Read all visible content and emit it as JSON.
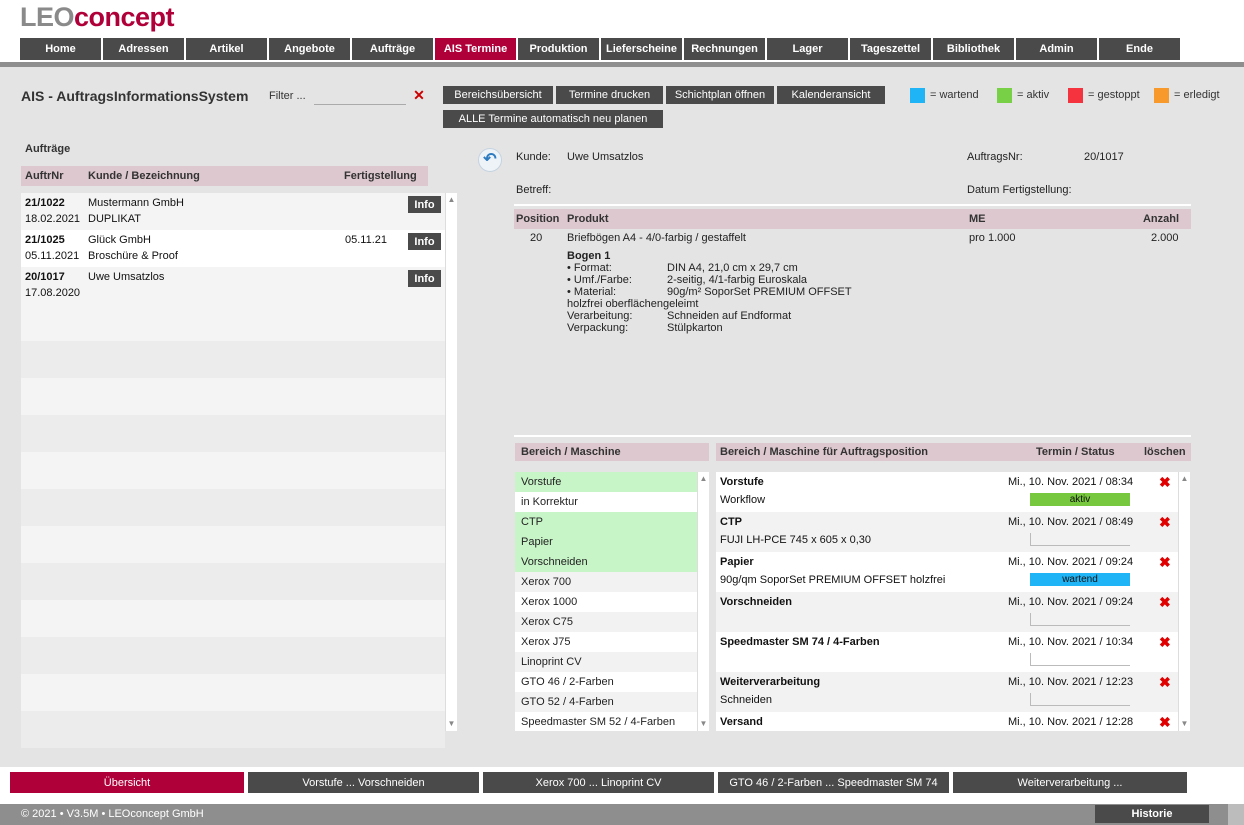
{
  "logo": {
    "leo": "LEO",
    "concept": "concept"
  },
  "nav": [
    {
      "label": "Home",
      "active": false
    },
    {
      "label": "Adressen",
      "active": false
    },
    {
      "label": "Artikel",
      "active": false
    },
    {
      "label": "Angebote",
      "active": false
    },
    {
      "label": "Aufträge",
      "active": false
    },
    {
      "label": "AIS Termine",
      "active": true
    },
    {
      "label": "Produktion",
      "active": false
    },
    {
      "label": "Lieferscheine",
      "active": false
    },
    {
      "label": "Rechnungen",
      "active": false
    },
    {
      "label": "Lager",
      "active": false
    },
    {
      "label": "Tageszettel",
      "active": false
    },
    {
      "label": "Bibliothek",
      "active": false
    },
    {
      "label": "Admin",
      "active": false
    },
    {
      "label": "Ende",
      "active": false
    }
  ],
  "page_title": "AIS - AuftragsInformationsSystem",
  "filter": {
    "label": "Filter ...",
    "value": ""
  },
  "toolbar": {
    "bereich": "Bereichsübersicht",
    "drucken": "Termine drucken",
    "schicht": "Schichtplan öffnen",
    "kalender": "Kalenderansicht",
    "neu_planen": "ALLE Termine automatisch neu planen"
  },
  "legend": [
    {
      "color": "#1fb4f5",
      "label": "= wartend"
    },
    {
      "color": "#77d046",
      "label": "= aktiv"
    },
    {
      "color": "#f5333f",
      "label": "= gestoppt"
    },
    {
      "color": "#f89a2b",
      "label": "= erledigt"
    }
  ],
  "orders": {
    "section_label": "Aufträge",
    "columns": {
      "nr": "AuftrNr",
      "kunde": "Kunde / Bezeichnung",
      "fert": "Fertigstellung"
    },
    "info_label": "Info",
    "rows": [
      {
        "nr": "21/1022",
        "date": "18.02.2021",
        "customer": "Mustermann GmbH",
        "desc": " DUPLIKAT",
        "fert": ""
      },
      {
        "nr": "21/1025",
        "date": "05.11.2021",
        "customer": "Glück GmbH",
        "desc": "Broschüre & Proof",
        "fert": "05.11.21"
      },
      {
        "nr": "20/1017",
        "date": "17.08.2020",
        "customer": "Uwe Umsatzlos",
        "desc": "",
        "fert": ""
      }
    ]
  },
  "detail": {
    "kunde_label": "Kunde:",
    "kunde": "Uwe Umsatzlos",
    "auftrag_label": "AuftragsNr:",
    "auftrag": "20/1017",
    "betreff_label": "Betreff:",
    "datum_label": "Datum Fertigstellung:",
    "columns": {
      "pos": "Position",
      "produkt": "Produkt",
      "me": "ME",
      "anzahl": "Anzahl"
    },
    "position": "20",
    "produkt": "Briefbögen A4 - 4/0-farbig / gestaffelt",
    "me": "pro 1.000",
    "anzahl": "2.000",
    "bogen_title": "Bogen 1",
    "spec_keys": "• Format:\n• Umf./Farbe:\n• Material:",
    "spec_vals": "DIN A4, 21,0 cm x 29,7 cm\n2-seitig, 4/1-farbig Euroskala\n90g/m² SoporSet PREMIUM OFFSET",
    "spec_extra": "holzfrei oberflächengeleimt",
    "spec_keys2": "Verarbeitung:\nVerpackung:",
    "spec_vals2": "Schneiden auf Endformat\nStülpkarton"
  },
  "machines": {
    "header": "Bereich / Maschine",
    "items": [
      {
        "label": "Vorstufe",
        "state": "green"
      },
      {
        "label": "in Korrektur",
        "state": "white"
      },
      {
        "label": "CTP",
        "state": "green"
      },
      {
        "label": "Papier",
        "state": "green"
      },
      {
        "label": "Vorschneiden",
        "state": "green"
      },
      {
        "label": "Xerox 700",
        "state": "alt"
      },
      {
        "label": "Xerox 1000",
        "state": "white"
      },
      {
        "label": "Xerox C75",
        "state": "alt"
      },
      {
        "label": "Xerox J75",
        "state": "white"
      },
      {
        "label": "Linoprint CV",
        "state": "alt"
      },
      {
        "label": "GTO 46 / 2-Farben",
        "state": "white"
      },
      {
        "label": "GTO 52 / 4-Farben",
        "state": "alt"
      },
      {
        "label": "Speedmaster SM 52 / 4-Farben",
        "state": "white"
      }
    ]
  },
  "schedule": {
    "header": "Bereich / Maschine für Auftragsposition",
    "header_termin": "Termin / Status",
    "header_loeschen": "löschen",
    "delete_glyph": "✖",
    "items": [
      {
        "name": "Vorstufe",
        "sub": "Workflow",
        "date": "Mi., 10. Nov. 2021  /   08:34",
        "status": "aktiv",
        "status_color": "#77c83e"
      },
      {
        "name": "CTP",
        "sub": "FUJI LH-PCE 745 x 605 x 0,30",
        "date": "Mi., 10. Nov. 2021  /   08:49",
        "status": "",
        "status_color": ""
      },
      {
        "name": "Papier",
        "sub": "90g/qm SoporSet PREMIUM OFFSET holzfrei",
        "date": "Mi., 10. Nov. 2021  /   09:24",
        "status": "wartend",
        "status_color": "#1fb4f5"
      },
      {
        "name": "Vorschneiden",
        "sub": "",
        "date": "Mi., 10. Nov. 2021  /   09:24",
        "status": "",
        "status_color": ""
      },
      {
        "name": "Speedmaster SM 74 / 4-Farben",
        "sub": "",
        "date": "Mi., 10. Nov. 2021  /   10:34",
        "status": "",
        "status_color": ""
      },
      {
        "name": "Weiterverarbeitung",
        "sub": "Schneiden",
        "date": "Mi., 10. Nov. 2021  /   12:23",
        "status": "",
        "status_color": ""
      },
      {
        "name": "Versand",
        "sub": "",
        "date": "Mi., 10. Nov. 2021  /   12:28",
        "status": "",
        "status_color": ""
      }
    ]
  },
  "bottom_tabs": [
    {
      "label": "Übersicht",
      "active": true
    },
    {
      "label": "Vorstufe ... Vorschneiden",
      "active": false
    },
    {
      "label": "Xerox 700 ... Linoprint CV",
      "active": false
    },
    {
      "label": "GTO 46 / 2-Farben ... Speedmaster SM 74",
      "active": false
    },
    {
      "label": "Weiterverarbeitung ...",
      "active": false
    }
  ],
  "footer": {
    "copyright": "© 2021 • V3.5M • LEOconcept GmbH",
    "historie": "Historie"
  }
}
